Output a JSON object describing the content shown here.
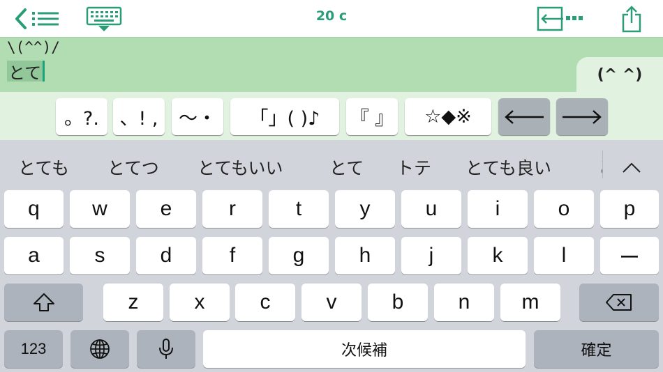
{
  "toolbar": {
    "char_count": "20 c",
    "icons": {
      "back": "chevron-left-icon",
      "list": "list-icon",
      "keyboard": "keyboard-icon",
      "export": "export-text-icon",
      "share": "share-icon"
    }
  },
  "editor": {
    "line1": "\\(^^)/",
    "line2_marked": "とて",
    "face_tab": "(^ ^)"
  },
  "symbols": [
    {
      "label": "。?.",
      "left": 0
    },
    {
      "label": "、! ,",
      "left": 0
    },
    {
      "label": "〜・",
      "left": 0
    },
    {
      "label": "「」( )♪",
      "left": 0
    },
    {
      "label": "『 』",
      "left": 0
    },
    {
      "label": "☆◆※",
      "left": 0
    },
    {
      "label": "←",
      "left": 0
    },
    {
      "label": "→",
      "left": 0
    }
  ],
  "candidates": [
    "とても",
    "とてつ",
    "とてもいい",
    "とて",
    "トテ",
    "とても良い",
    "と"
  ],
  "keyboard": {
    "row1": [
      "q",
      "w",
      "e",
      "r",
      "t",
      "y",
      "u",
      "i",
      "o",
      "p"
    ],
    "row2": [
      "a",
      "s",
      "d",
      "f",
      "g",
      "h",
      "j",
      "k",
      "l",
      "ー"
    ],
    "row3": [
      "z",
      "x",
      "c",
      "v",
      "b",
      "n",
      "m"
    ],
    "numbers_label": "123",
    "space_label": "次候補",
    "enter_label": "確定"
  },
  "colors": {
    "accent": "#2a9d78",
    "editor_bg": "#b2dcb2",
    "symbols_bg": "#e1f2e1",
    "keyboard_bg": "#d1d5db"
  }
}
